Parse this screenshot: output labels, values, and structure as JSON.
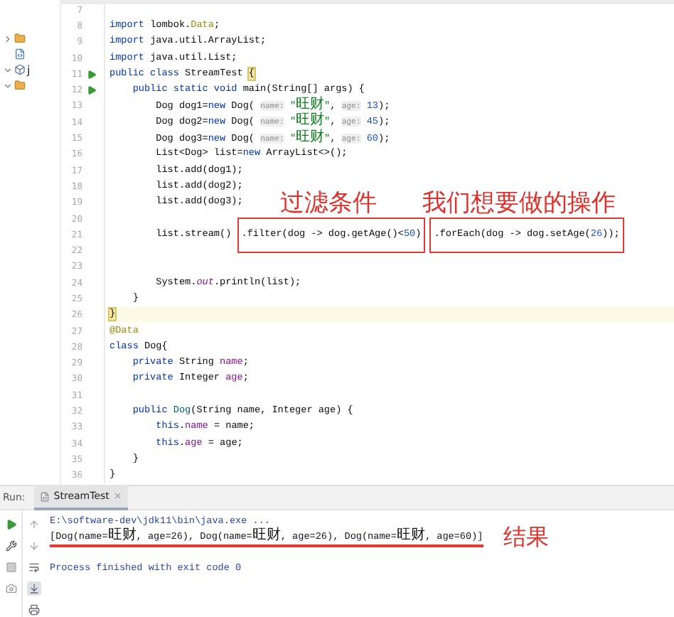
{
  "project_tree": [
    {
      "kind": "folder",
      "expanded": false
    },
    {
      "kind": "file"
    },
    {
      "kind": "module",
      "expanded": true,
      "label": "j"
    },
    {
      "kind": "folder",
      "expanded": true
    }
  ],
  "editor": {
    "lines": [
      {
        "number": "7"
      },
      {
        "number": "8",
        "tokens": [
          {
            "kind": "keyword",
            "text": "import"
          },
          {
            "kind": "plain",
            "text": " lombok."
          },
          {
            "kind": "annotation",
            "text": "Data"
          },
          {
            "kind": "plain",
            "text": ";"
          }
        ]
      },
      {
        "number": "9",
        "tokens": [
          {
            "kind": "keyword",
            "text": "import"
          },
          {
            "kind": "plain",
            "text": " java.util.ArrayList;"
          }
        ]
      },
      {
        "number": "10",
        "tokens": [
          {
            "kind": "keyword",
            "text": "import"
          },
          {
            "kind": "plain",
            "text": " java.util.List;"
          }
        ]
      },
      {
        "number": "11",
        "run": true,
        "tokens": [
          {
            "kind": "keyword",
            "text": "public class"
          },
          {
            "kind": "plain",
            "text": " StreamTest "
          },
          {
            "kind": "brace",
            "text": "{"
          }
        ]
      },
      {
        "number": "12",
        "run": true,
        "tokens": [
          {
            "kind": "keyword",
            "text": "    public static void"
          },
          {
            "kind": "plain",
            "text": " main(String[] args) {"
          }
        ]
      },
      {
        "number": "13",
        "tokens": [
          {
            "kind": "plain",
            "text": "        Dog dog1="
          },
          {
            "kind": "keyword",
            "text": "new"
          },
          {
            "kind": "plain",
            "text": " Dog( "
          },
          {
            "kind": "hint",
            "text": "name:"
          },
          {
            "kind": "string",
            "text": " \"旺财\""
          },
          {
            "kind": "plain",
            "text": ", "
          },
          {
            "kind": "hint",
            "text": "age:"
          },
          {
            "kind": "number",
            "text": " 13"
          },
          {
            "kind": "plain",
            "text": ");"
          }
        ]
      },
      {
        "number": "14",
        "tokens": [
          {
            "kind": "plain",
            "text": "        Dog dog2="
          },
          {
            "kind": "keyword",
            "text": "new"
          },
          {
            "kind": "plain",
            "text": " Dog( "
          },
          {
            "kind": "hint",
            "text": "name:"
          },
          {
            "kind": "string",
            "text": " \"旺财\""
          },
          {
            "kind": "plain",
            "text": ", "
          },
          {
            "kind": "hint",
            "text": "age:"
          },
          {
            "kind": "number",
            "text": " 45"
          },
          {
            "kind": "plain",
            "text": ");"
          }
        ]
      },
      {
        "number": "15",
        "tokens": [
          {
            "kind": "plain",
            "text": "        Dog dog3="
          },
          {
            "kind": "keyword",
            "text": "new"
          },
          {
            "kind": "plain",
            "text": " Dog( "
          },
          {
            "kind": "hint",
            "text": "name:"
          },
          {
            "kind": "string",
            "text": " \"旺财\""
          },
          {
            "kind": "plain",
            "text": ", "
          },
          {
            "kind": "hint",
            "text": "age:"
          },
          {
            "kind": "number",
            "text": " 60"
          },
          {
            "kind": "plain",
            "text": ");"
          }
        ]
      },
      {
        "number": "16",
        "tokens": [
          {
            "kind": "plain",
            "text": "        List<Dog> list="
          },
          {
            "kind": "keyword",
            "text": "new"
          },
          {
            "kind": "plain",
            "text": " ArrayList<>();"
          }
        ]
      },
      {
        "number": "17",
        "tokens": [
          {
            "kind": "plain",
            "text": "        list.add(dog1);"
          }
        ]
      },
      {
        "number": "18",
        "tokens": [
          {
            "kind": "plain",
            "text": "        list.add(dog2);"
          }
        ]
      },
      {
        "number": "19",
        "tokens": [
          {
            "kind": "plain",
            "text": "        list.add(dog3);"
          }
        ],
        "notes": [
          "过滤条件",
          "我们想要做的操作"
        ]
      },
      {
        "number": "20"
      },
      {
        "number": "21",
        "tokens": [
          {
            "kind": "plain",
            "text": "        list.stream() "
          },
          {
            "kind": "box",
            "tokens": [
              {
                "kind": "plain",
                "text": ".filter(dog -> dog.getAge()<"
              },
              {
                "kind": "number",
                "text": "50"
              },
              {
                "kind": "plain",
                "text": ")"
              }
            ]
          },
          {
            "kind": "box",
            "tokens": [
              {
                "kind": "plain",
                "text": ".forEach(dog -> dog.setAge("
              },
              {
                "kind": "number",
                "text": "26"
              },
              {
                "kind": "plain",
                "text": "));"
              }
            ]
          }
        ]
      },
      {
        "number": "22"
      },
      {
        "number": "23"
      },
      {
        "number": "24",
        "tokens": [
          {
            "kind": "plain",
            "text": "        System."
          },
          {
            "kind": "static",
            "text": "out"
          },
          {
            "kind": "plain",
            "text": ".println(list);"
          }
        ]
      },
      {
        "number": "25",
        "tokens": [
          {
            "kind": "plain",
            "text": "    }"
          }
        ]
      },
      {
        "number": "26",
        "current": true,
        "tokens": [
          {
            "kind": "brace",
            "text": "}"
          }
        ]
      },
      {
        "number": "27",
        "tokens": [
          {
            "kind": "annotation",
            "text": "@Data"
          }
        ]
      },
      {
        "number": "28",
        "tokens": [
          {
            "kind": "keyword",
            "text": "class"
          },
          {
            "kind": "plain",
            "text": " Dog{"
          }
        ]
      },
      {
        "number": "29",
        "tokens": [
          {
            "kind": "keyword",
            "text": "    private"
          },
          {
            "kind": "plain",
            "text": " String "
          },
          {
            "kind": "field",
            "text": "name"
          },
          {
            "kind": "plain",
            "text": ";"
          }
        ]
      },
      {
        "number": "30",
        "tokens": [
          {
            "kind": "keyword",
            "text": "    private"
          },
          {
            "kind": "plain",
            "text": " Integer "
          },
          {
            "kind": "field",
            "text": "age"
          },
          {
            "kind": "plain",
            "text": ";"
          }
        ]
      },
      {
        "number": "31"
      },
      {
        "number": "32",
        "tokens": [
          {
            "kind": "keyword",
            "text": "    public"
          },
          {
            "kind": "method",
            "text": " Dog"
          },
          {
            "kind": "plain",
            "text": "(String name, Integer age) {"
          }
        ]
      },
      {
        "number": "33",
        "tokens": [
          {
            "kind": "keyword",
            "text": "        this"
          },
          {
            "kind": "plain",
            "text": "."
          },
          {
            "kind": "field",
            "text": "name"
          },
          {
            "kind": "plain",
            "text": " = name;"
          }
        ]
      },
      {
        "number": "34",
        "tokens": [
          {
            "kind": "keyword",
            "text": "        this"
          },
          {
            "kind": "plain",
            "text": "."
          },
          {
            "kind": "field",
            "text": "age"
          },
          {
            "kind": "plain",
            "text": " = age;"
          }
        ]
      },
      {
        "number": "35",
        "tokens": [
          {
            "kind": "plain",
            "text": "    }"
          }
        ]
      },
      {
        "number": "36",
        "tokens": [
          {
            "kind": "plain",
            "text": "}"
          }
        ]
      }
    ]
  },
  "run_panel": {
    "label": "Run:",
    "tabs": [
      {
        "label": "StreamTest",
        "selected": true,
        "close": "×"
      }
    ],
    "output": [
      {
        "kind": "command",
        "text": "E:\\software-dev\\jdk11\\bin\\java.exe ..."
      },
      {
        "kind": "result",
        "text": "[Dog(name=旺财, age=26), Dog(name=旺财, age=26), Dog(name=旺财, age=60)]",
        "underlined": true,
        "note": "结果"
      },
      {
        "kind": "status",
        "text": "Process finished with exit code 0"
      }
    ]
  }
}
